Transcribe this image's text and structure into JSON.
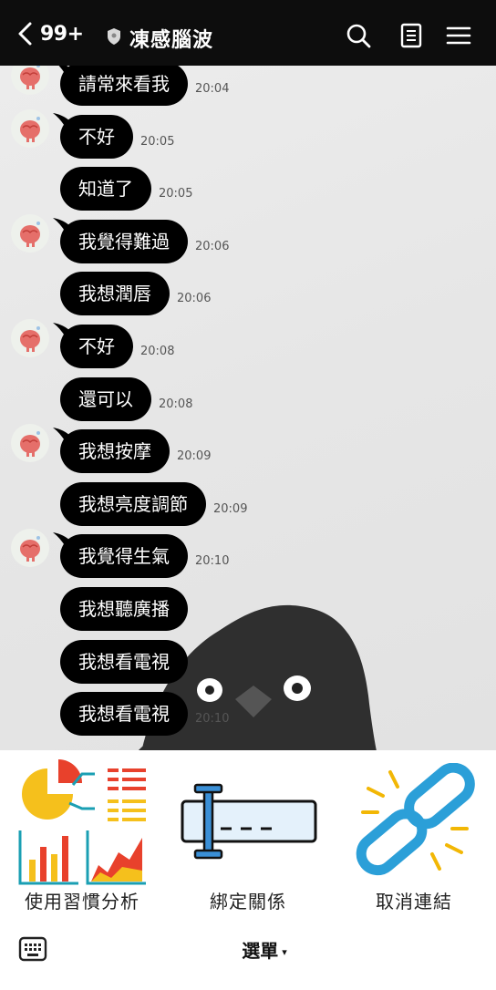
{
  "header": {
    "back_count": "99+",
    "title": "凍感腦波"
  },
  "messages": [
    {
      "text": "請常來看我",
      "time": "20:04",
      "avatar": true
    },
    {
      "text": "不好",
      "time": "20:05",
      "avatar": true
    },
    {
      "text": "知道了",
      "time": "20:05",
      "avatar": false
    },
    {
      "text": "我覺得難過",
      "time": "20:06",
      "avatar": true
    },
    {
      "text": "我想潤唇",
      "time": "20:06",
      "avatar": false
    },
    {
      "text": "不好",
      "time": "20:08",
      "avatar": true
    },
    {
      "text": "還可以",
      "time": "20:08",
      "avatar": false
    },
    {
      "text": "我想按摩",
      "time": "20:09",
      "avatar": true
    },
    {
      "text": "我想亮度調節",
      "time": "20:09",
      "avatar": false
    },
    {
      "text": "我覺得生氣",
      "time": "20:10",
      "avatar": true
    },
    {
      "text": "我想聽廣播",
      "time": "",
      "avatar": false
    },
    {
      "text": "我想看電視",
      "time": "",
      "avatar": false
    },
    {
      "text": "我想看電視",
      "time": "20:10",
      "avatar": false
    }
  ],
  "rich_menu": {
    "items": [
      {
        "label": "使用習慣分析",
        "icon": "usage-analysis-icon"
      },
      {
        "label": "綁定關係",
        "icon": "bind-relation-icon"
      },
      {
        "label": "取消連結",
        "icon": "unlink-icon"
      }
    ]
  },
  "bottom": {
    "menu_label": "選單",
    "caret": "▾"
  },
  "colors": {
    "header_bg": "#0d0d0d",
    "bubble_bg": "#000000",
    "chat_bg": "#e9e9e9",
    "unlink_blue": "#2b9fd8",
    "spark_yellow": "#f2b705",
    "chart_red": "#e8412c",
    "chart_teal": "#1a9fb3"
  }
}
